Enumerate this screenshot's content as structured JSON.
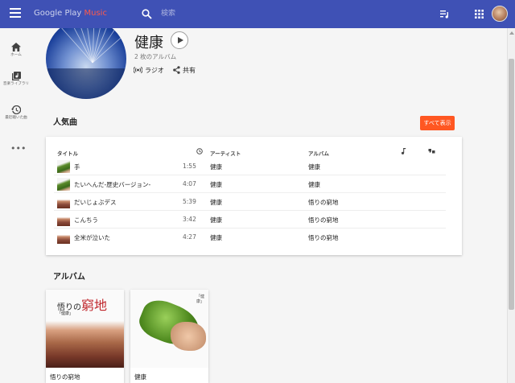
{
  "app": {
    "logo_main": "Google Play ",
    "logo_accent": "Music",
    "search_placeholder": "検索"
  },
  "rail": {
    "home": "ホーム",
    "library": "音楽ライブラリ",
    "recent": "最近聴いた曲",
    "more": "•••"
  },
  "artist": {
    "name": "健康",
    "album_count": "2 枚のアルバム",
    "radio_label": "ラジオ",
    "share_label": "共有"
  },
  "top_songs": {
    "title": "人気曲",
    "show_all": "すべて表示",
    "headers": {
      "title": "タイトル",
      "artist": "アーティスト",
      "album": "アルバム"
    },
    "rows": [
      {
        "title": "手",
        "duration": "1:55",
        "artist": "健康",
        "album": "健康",
        "thumb": "bitter"
      },
      {
        "title": "たいへんだ-歴史バージョン-",
        "duration": "4:07",
        "artist": "健康",
        "album": "健康",
        "thumb": "bitter"
      },
      {
        "title": "だいじょぶデス",
        "duration": "5:39",
        "artist": "健康",
        "album": "悟りの窮地",
        "thumb": "hands"
      },
      {
        "title": "こんちう",
        "duration": "3:42",
        "artist": "健康",
        "album": "悟りの窮地",
        "thumb": "hands"
      },
      {
        "title": "全米が泣いた",
        "duration": "4:27",
        "artist": "健康",
        "album": "悟りの窮地",
        "thumb": "hands"
      }
    ]
  },
  "albums": {
    "title": "アルバム",
    "items": [
      {
        "name": "悟りの窮地",
        "art_text_small": "悟りの",
        "art_text_big": "窮地",
        "art_sub": "「健康」"
      },
      {
        "name": "健康",
        "art_text": "「健康」"
      }
    ]
  },
  "colors": {
    "topbar": "#3f51b5",
    "accent": "#ff5722"
  }
}
